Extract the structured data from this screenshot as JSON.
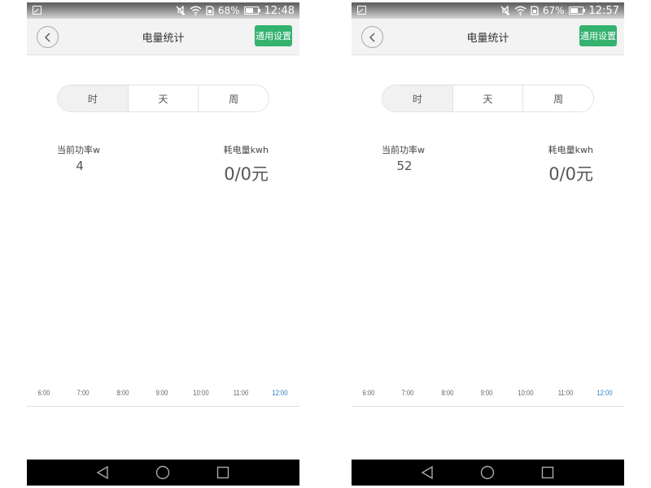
{
  "screens": [
    {
      "status_bar": {
        "battery_percent": "68%",
        "battery_level": 0.68,
        "time": "12:48"
      },
      "header": {
        "title": "电量统计",
        "settings_label": "通用设置"
      },
      "tabs": [
        {
          "label": "时",
          "active": true
        },
        {
          "label": "天",
          "active": false
        },
        {
          "label": "周",
          "active": false
        }
      ],
      "power": {
        "label": "当前功率w",
        "value": "4"
      },
      "energy": {
        "label": "耗电量kwh",
        "value": "0/0元"
      },
      "time_axis": [
        "6:00",
        "7:00",
        "8:00",
        "9:00",
        "10:00",
        "11:00",
        "12:00"
      ],
      "current_tick": "12:00"
    },
    {
      "status_bar": {
        "battery_percent": "67%",
        "battery_level": 0.67,
        "time": "12:57"
      },
      "header": {
        "title": "电量统计",
        "settings_label": "通用设置"
      },
      "tabs": [
        {
          "label": "时",
          "active": true
        },
        {
          "label": "天",
          "active": false
        },
        {
          "label": "周",
          "active": false
        }
      ],
      "power": {
        "label": "当前功率w",
        "value": "52"
      },
      "energy": {
        "label": "耗电量kwh",
        "value": "0/0元"
      },
      "time_axis": [
        "6:00",
        "7:00",
        "8:00",
        "9:00",
        "10:00",
        "11:00",
        "12:00"
      ],
      "current_tick": "12:00"
    }
  ],
  "colors": {
    "accent_green": "#34b26f",
    "current_tick_blue": "#2f7fc1",
    "nav_bar": "#000000"
  },
  "icons": {
    "status_bar": [
      "gallery-icon",
      "mute-icon",
      "wifi-icon",
      "sim-icon",
      "battery-icon"
    ],
    "header": [
      "back-chevron-icon"
    ],
    "nav_bar": [
      "back-triangle-icon",
      "home-circle-icon",
      "recents-square-icon"
    ]
  }
}
